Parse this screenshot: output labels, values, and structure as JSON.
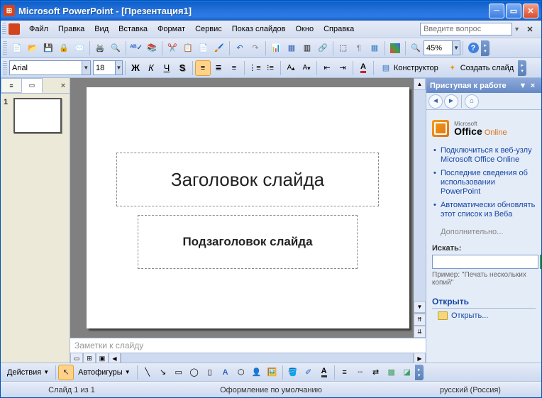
{
  "title": "Microsoft PowerPoint - [Презентация1]",
  "menu": {
    "file": "Файл",
    "edit": "Правка",
    "view": "Вид",
    "insert": "Вставка",
    "format": "Формат",
    "tools": "Сервис",
    "slideshow": "Показ слайдов",
    "window": "Окно",
    "help": "Справка"
  },
  "question_placeholder": "Введите вопрос",
  "font": {
    "name": "Arial",
    "size": "18"
  },
  "zoom": "45%",
  "designer_label": "Конструктор",
  "new_slide_label": "Создать слайд",
  "slide": {
    "title": "Заголовок слайда",
    "subtitle": "Подзаголовок слайда",
    "number": "1"
  },
  "notes_placeholder": "Заметки к слайду",
  "taskpane": {
    "title": "Приступая к работе",
    "office_prefix": "Microsoft",
    "office_main": "Office",
    "office_suffix": "Online",
    "links": [
      "Подключиться к веб-узлу Microsoft Office Online",
      "Последние сведения об использовании PowerPoint",
      "Автоматически обновлять этот список из Веба"
    ],
    "more": "Дополнительно...",
    "search_label": "Искать:",
    "example": "Пример: \"Печать нескольких копий\"",
    "open_header": "Открыть",
    "open_link": "Открыть..."
  },
  "drawing": {
    "actions": "Действия",
    "autoshapes": "Автофигуры"
  },
  "status": {
    "slide": "Слайд 1 из 1",
    "design": "Оформление по умолчанию",
    "lang": "русский (Россия)"
  }
}
